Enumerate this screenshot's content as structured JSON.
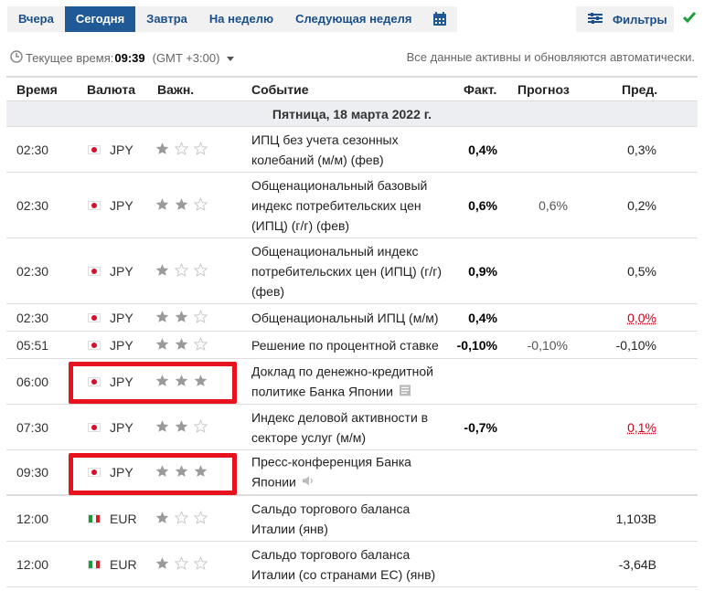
{
  "tabs": [
    {
      "label": "Вчера"
    },
    {
      "label": "Сегодня",
      "active": true
    },
    {
      "label": "Завтра"
    },
    {
      "label": "На неделю"
    },
    {
      "label": "Следующая неделя"
    }
  ],
  "filters_label": "Фильтры",
  "time_bar": {
    "label": "Текущее время:",
    "time": "09:39",
    "tz": "(GMT +3:00)",
    "note": "Все данные активны и обновляются автоматически."
  },
  "columns": {
    "time": "Время",
    "currency": "Валюта",
    "importance": "Важн.",
    "event": "Событие",
    "actual": "Факт.",
    "forecast": "Прогноз",
    "previous": "Пред."
  },
  "date_header": "Пятница, 18 марта 2022 г.",
  "colors": {
    "accent": "#1f5a96",
    "highlight": "#e8121e",
    "negative": "#d0021b",
    "star_on": "#9a9a9a",
    "star_off": "#c8c8c8"
  },
  "rows": [
    {
      "time": "02:30",
      "currency": "JPY",
      "importance": 1,
      "event": "ИПЦ без учета сезонных колебаний (м/м) (фев)",
      "actual": "0,4%",
      "forecast": "",
      "previous": "0,3%"
    },
    {
      "time": "02:30",
      "currency": "JPY",
      "importance": 2,
      "event": "Общенациональный базовый индекс потребительских цен (ИПЦ) (г/г) (фев)",
      "actual": "0,6%",
      "forecast": "0,6%",
      "previous": "0,2%"
    },
    {
      "time": "02:30",
      "currency": "JPY",
      "importance": 1,
      "event": "Общенациональный индекс потребительских цен (ИПЦ) (г/г) (фев)",
      "actual": "0,9%",
      "forecast": "",
      "previous": "0,5%"
    },
    {
      "time": "02:30",
      "currency": "JPY",
      "importance": 2,
      "event": "Общенациональный ИПЦ (м/м)",
      "actual": "0,4%",
      "forecast": "",
      "previous": "0,0%",
      "previous_red": true
    },
    {
      "time": "05:51",
      "currency": "JPY",
      "importance": 2,
      "event": "Решение по процентной ставке",
      "actual": "-0,10%",
      "forecast": "-0,10%",
      "previous": "-0,10%"
    },
    {
      "time": "06:00",
      "currency": "JPY",
      "importance": 3,
      "event": "Доклад по денежно-кредитной политике Банка Японии",
      "actual": "",
      "forecast": "",
      "previous": "",
      "event_icon": "document-icon",
      "highlighted": true
    },
    {
      "time": "07:30",
      "currency": "JPY",
      "importance": 2,
      "event": "Индекс деловой активности в секторе услуг (м/м)",
      "actual": "-0,7%",
      "forecast": "",
      "previous": "0,1%",
      "previous_red": true
    },
    {
      "time": "09:30",
      "currency": "JPY",
      "importance": 3,
      "event": "Пресс-конференция Банка Японии",
      "actual": "",
      "forecast": "",
      "previous": "",
      "event_icon": "speaker-icon",
      "highlighted": true
    },
    {
      "time": "12:00",
      "currency": "EUR",
      "flag": "italy",
      "importance": 1,
      "event": "Сальдо торгового баланса Италии (янв)",
      "actual": "",
      "forecast": "",
      "previous": "1,103B"
    },
    {
      "time": "12:00",
      "currency": "EUR",
      "flag": "italy",
      "importance": 1,
      "event": "Сальдо торгового баланса Италии (со странами ЕС) (янв)",
      "actual": "",
      "forecast": "",
      "previous": "-3,64B"
    }
  ]
}
